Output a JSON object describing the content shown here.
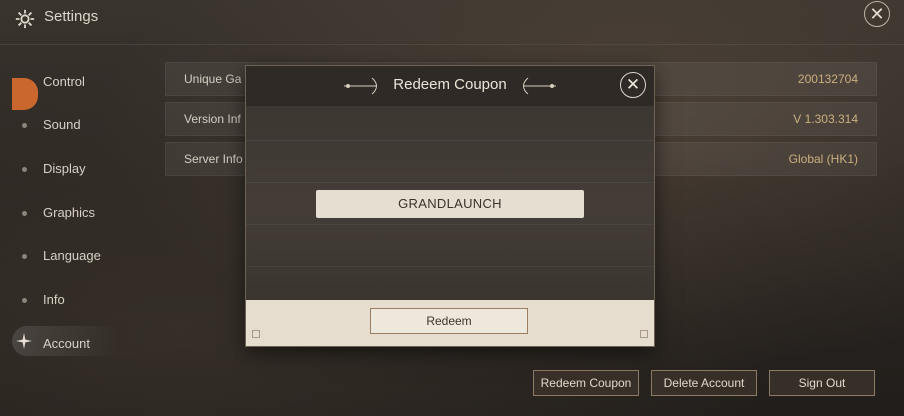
{
  "header": {
    "title": "Settings",
    "close_icon": "close-icon",
    "settings_icon": "gear-icon"
  },
  "sidebar": {
    "items": [
      {
        "label": "Control"
      },
      {
        "label": "Sound"
      },
      {
        "label": "Display"
      },
      {
        "label": "Graphics"
      },
      {
        "label": "Language"
      },
      {
        "label": "Info"
      },
      {
        "label": "Account"
      }
    ],
    "active": "Account",
    "accent": "#c9672f"
  },
  "info": {
    "rows": [
      {
        "key": "Unique Ga",
        "value": "200132704"
      },
      {
        "key": "Version Inf",
        "value": "V 1.303.314"
      },
      {
        "key": "Server Info",
        "value": "Global (HK1)"
      }
    ]
  },
  "actions": {
    "redeem_coupon": "Redeem Coupon",
    "delete_account": "Delete Account",
    "sign_out": "Sign Out"
  },
  "modal": {
    "title": "Redeem Coupon",
    "coupon_value": "GRANDLAUNCH",
    "redeem_button": "Redeem"
  }
}
